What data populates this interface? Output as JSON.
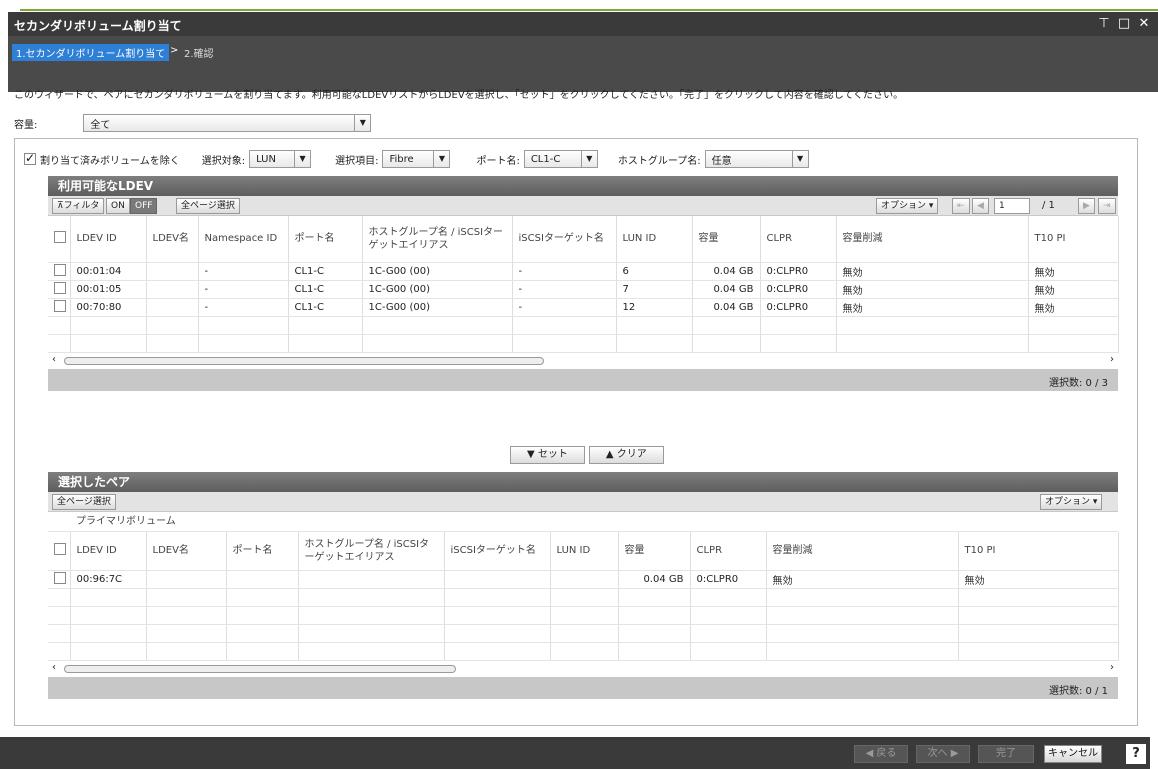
{
  "window": {
    "title": "セカンダリボリューム割り当て",
    "btn_restore": "⊤",
    "btn_max": "□",
    "btn_close": "✕"
  },
  "steps": {
    "current": "1.セカンダリボリューム割り当て",
    "sep": ">",
    "next": "2.確認"
  },
  "description": "このウィザードで、ペアにセカンダリボリュームを割り当てます。利用可能なLDEVリストからLDEVを選択し、「セット」をクリックしてください。「完了」をクリックして内容を確認してください。",
  "capacity": {
    "label": "容量:",
    "value": "全て"
  },
  "filters": {
    "exclude_label": "割り当て済みボリュームを除く",
    "target_label": "選択対象:",
    "target_value": "LUN",
    "item_label": "選択項目:",
    "item_value": "Fibre",
    "port_label": "ポート名:",
    "port_value": "CL1-C",
    "hostgroup_label": "ホストグループ名:",
    "hostgroup_value": "任意"
  },
  "available": {
    "title": "利用可能なLDEV",
    "filter_btn": "⊼フィルタ",
    "on": "ON",
    "off": "OFF",
    "select_all": "全ページ選択",
    "options": "オプション ▾",
    "page": "1",
    "page_total": "/ 1",
    "columns": [
      "LDEV ID",
      "LDEV名",
      "Namespace ID",
      "ポート名",
      "ホストグループ名 / iSCSIターゲットエイリアス",
      "iSCSIターゲット名",
      "LUN ID",
      "容量",
      "CLPR",
      "容量削減",
      "T10 PI"
    ],
    "rows": [
      [
        "00:01:04",
        "",
        "-",
        "CL1-C",
        "1C-G00 (00)",
        "-",
        "6",
        "0.04 GB",
        "0:CLPR0",
        "無効",
        "無効"
      ],
      [
        "00:01:05",
        "",
        "-",
        "CL1-C",
        "1C-G00 (00)",
        "-",
        "7",
        "0.04 GB",
        "0:CLPR0",
        "無効",
        "無効"
      ],
      [
        "00:70:80",
        "",
        "-",
        "CL1-C",
        "1C-G00 (00)",
        "-",
        "12",
        "0.04 GB",
        "0:CLPR0",
        "無効",
        "無効"
      ]
    ],
    "selected_count": "選択数:  0   /   3"
  },
  "actions": {
    "set": "▼ セット",
    "clear": "▲ クリア"
  },
  "pairs": {
    "title": "選択したペア",
    "select_all": "全ページ選択",
    "options": "オプション ▾",
    "group_label": "プライマリボリューム",
    "columns": [
      "LDEV ID",
      "LDEV名",
      "ポート名",
      "ホストグループ名 / iSCSIターゲットエイリアス",
      "iSCSIターゲット名",
      "LUN ID",
      "容量",
      "CLPR",
      "容量削減",
      "T10 PI"
    ],
    "rows": [
      [
        "00:96:7C",
        "",
        "",
        "",
        "",
        "",
        "0.04 GB",
        "0:CLPR0",
        "無効",
        "無効"
      ]
    ],
    "selected_count": "選択数:  0   /   1"
  },
  "bottom": {
    "back": "◀ 戻る",
    "next": "次へ ▶",
    "finish": "完了",
    "cancel": "キャンセル",
    "help": "?"
  }
}
